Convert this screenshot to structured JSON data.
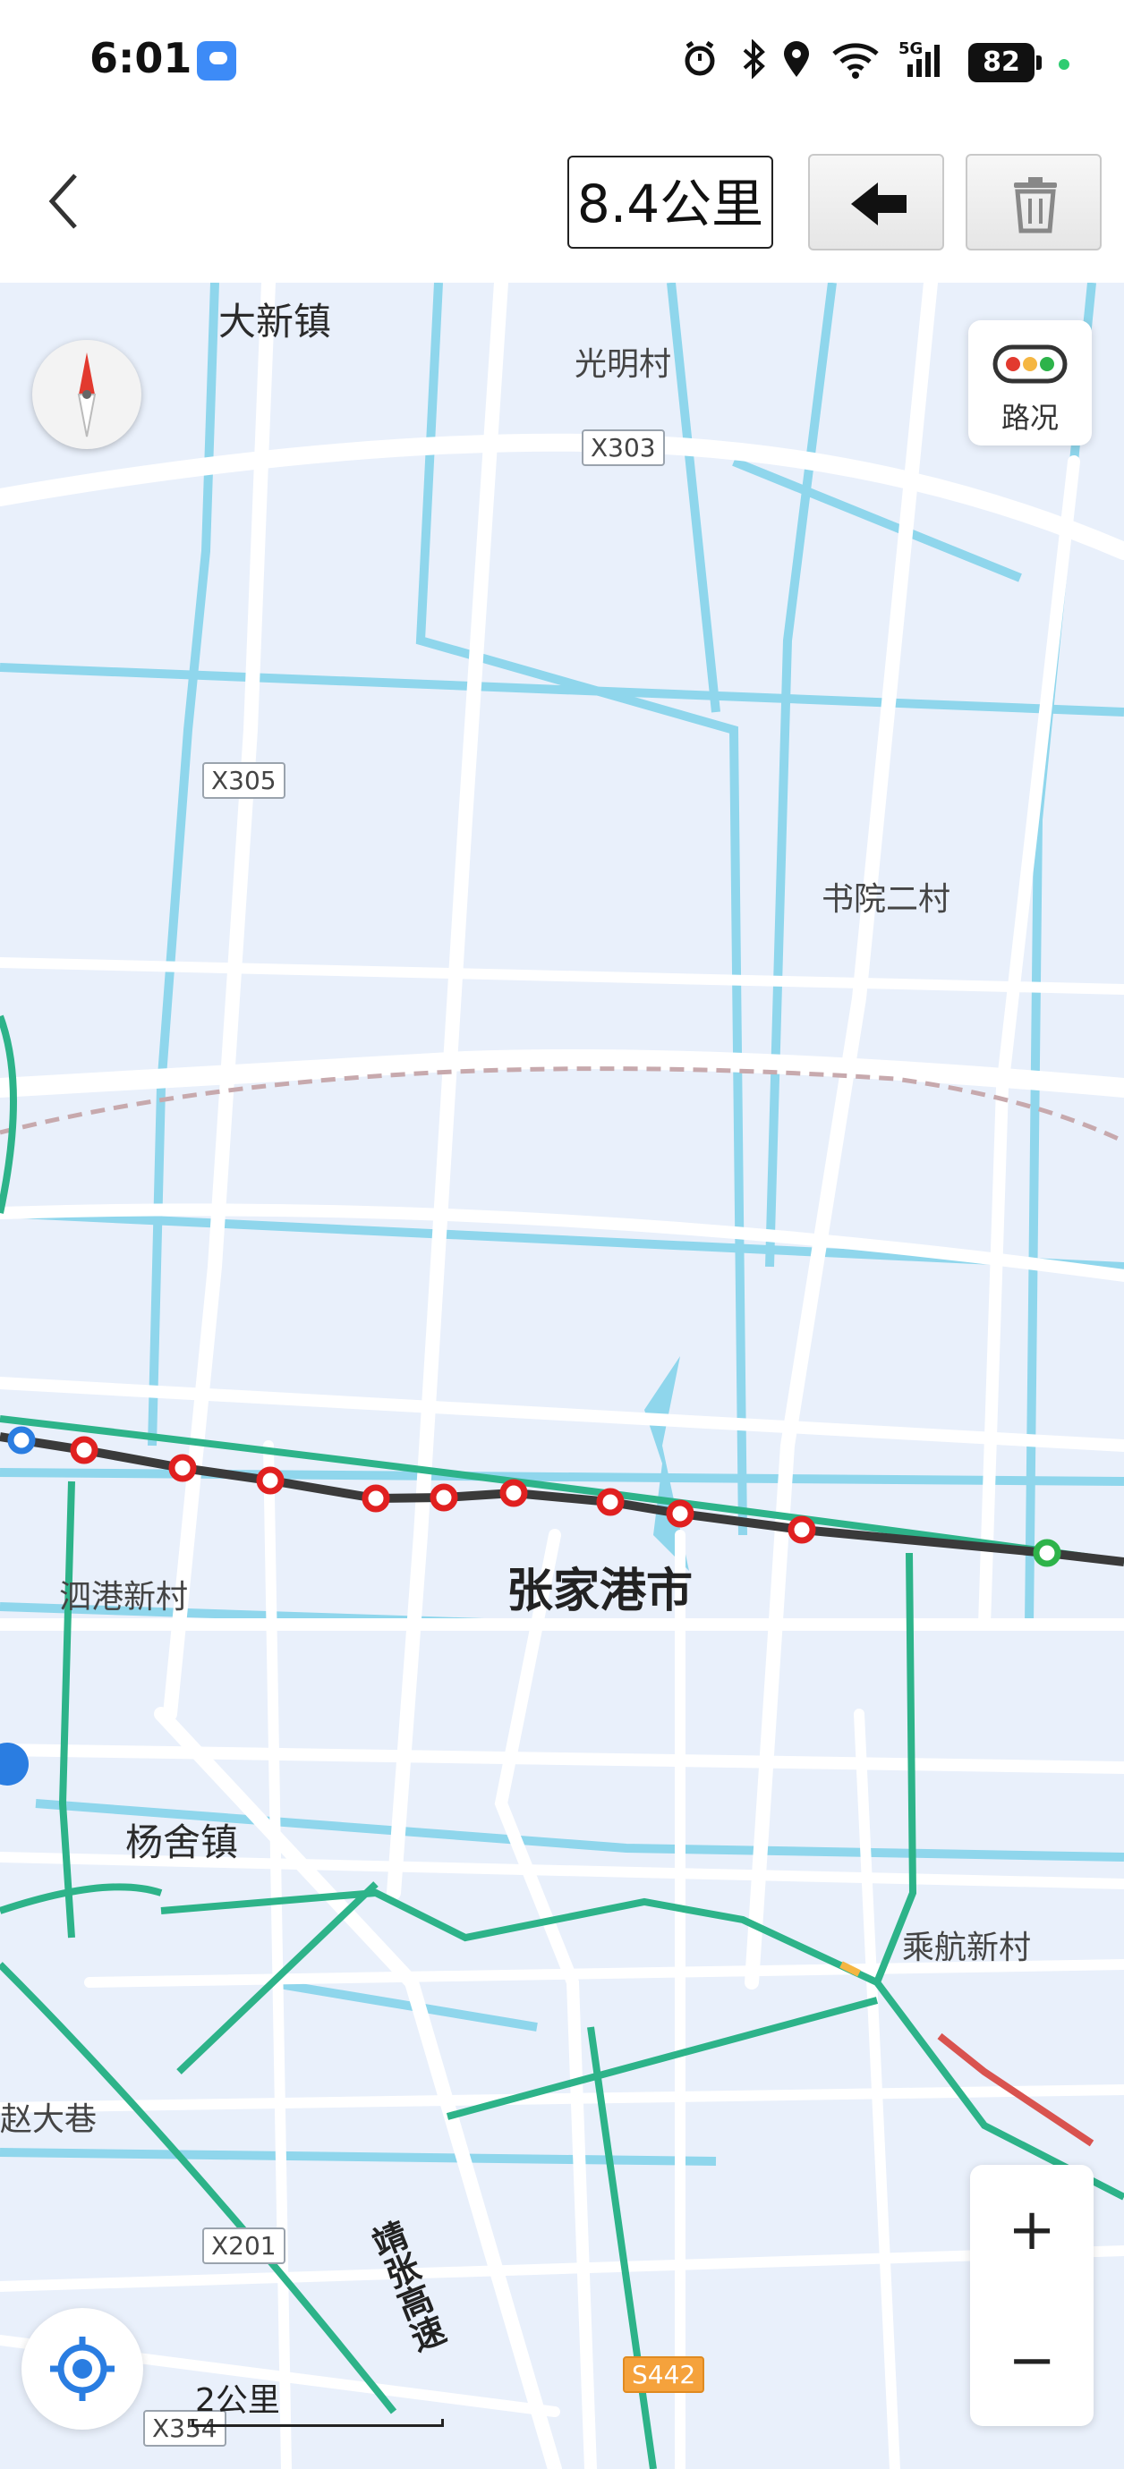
{
  "status_bar": {
    "time": "6:01",
    "battery": "82",
    "network": "5G"
  },
  "toolbar": {
    "distance": "8.4公里"
  },
  "map": {
    "labels": {
      "town_daxin": "大新镇",
      "village_guangming": "光明村",
      "village_shuyuan": "书院二村",
      "city_zhangjiagang": "张家港市",
      "village_sigang": "泗港新村",
      "town_yangshe": "杨舍镇",
      "village_chenghang": "乘航新村",
      "village_zhaoda": "赵大巷"
    },
    "shields": {
      "x303": "X303",
      "x305": "X305",
      "x201": "X201",
      "x354": "X354",
      "s442": "S442"
    },
    "expressway_name": "靖张高速",
    "traffic_label": "路况",
    "scale_label": "2公里"
  },
  "zoom": {
    "in": "+",
    "out": "−"
  },
  "colors": {
    "route_line": "#3a3a3a",
    "route_node": "#e02020",
    "end_node": "#2db34a",
    "start_node": "#2a7de1",
    "water": "#8fd6ec",
    "highway": "#2db389",
    "map_bg": "#e9f0fb"
  }
}
